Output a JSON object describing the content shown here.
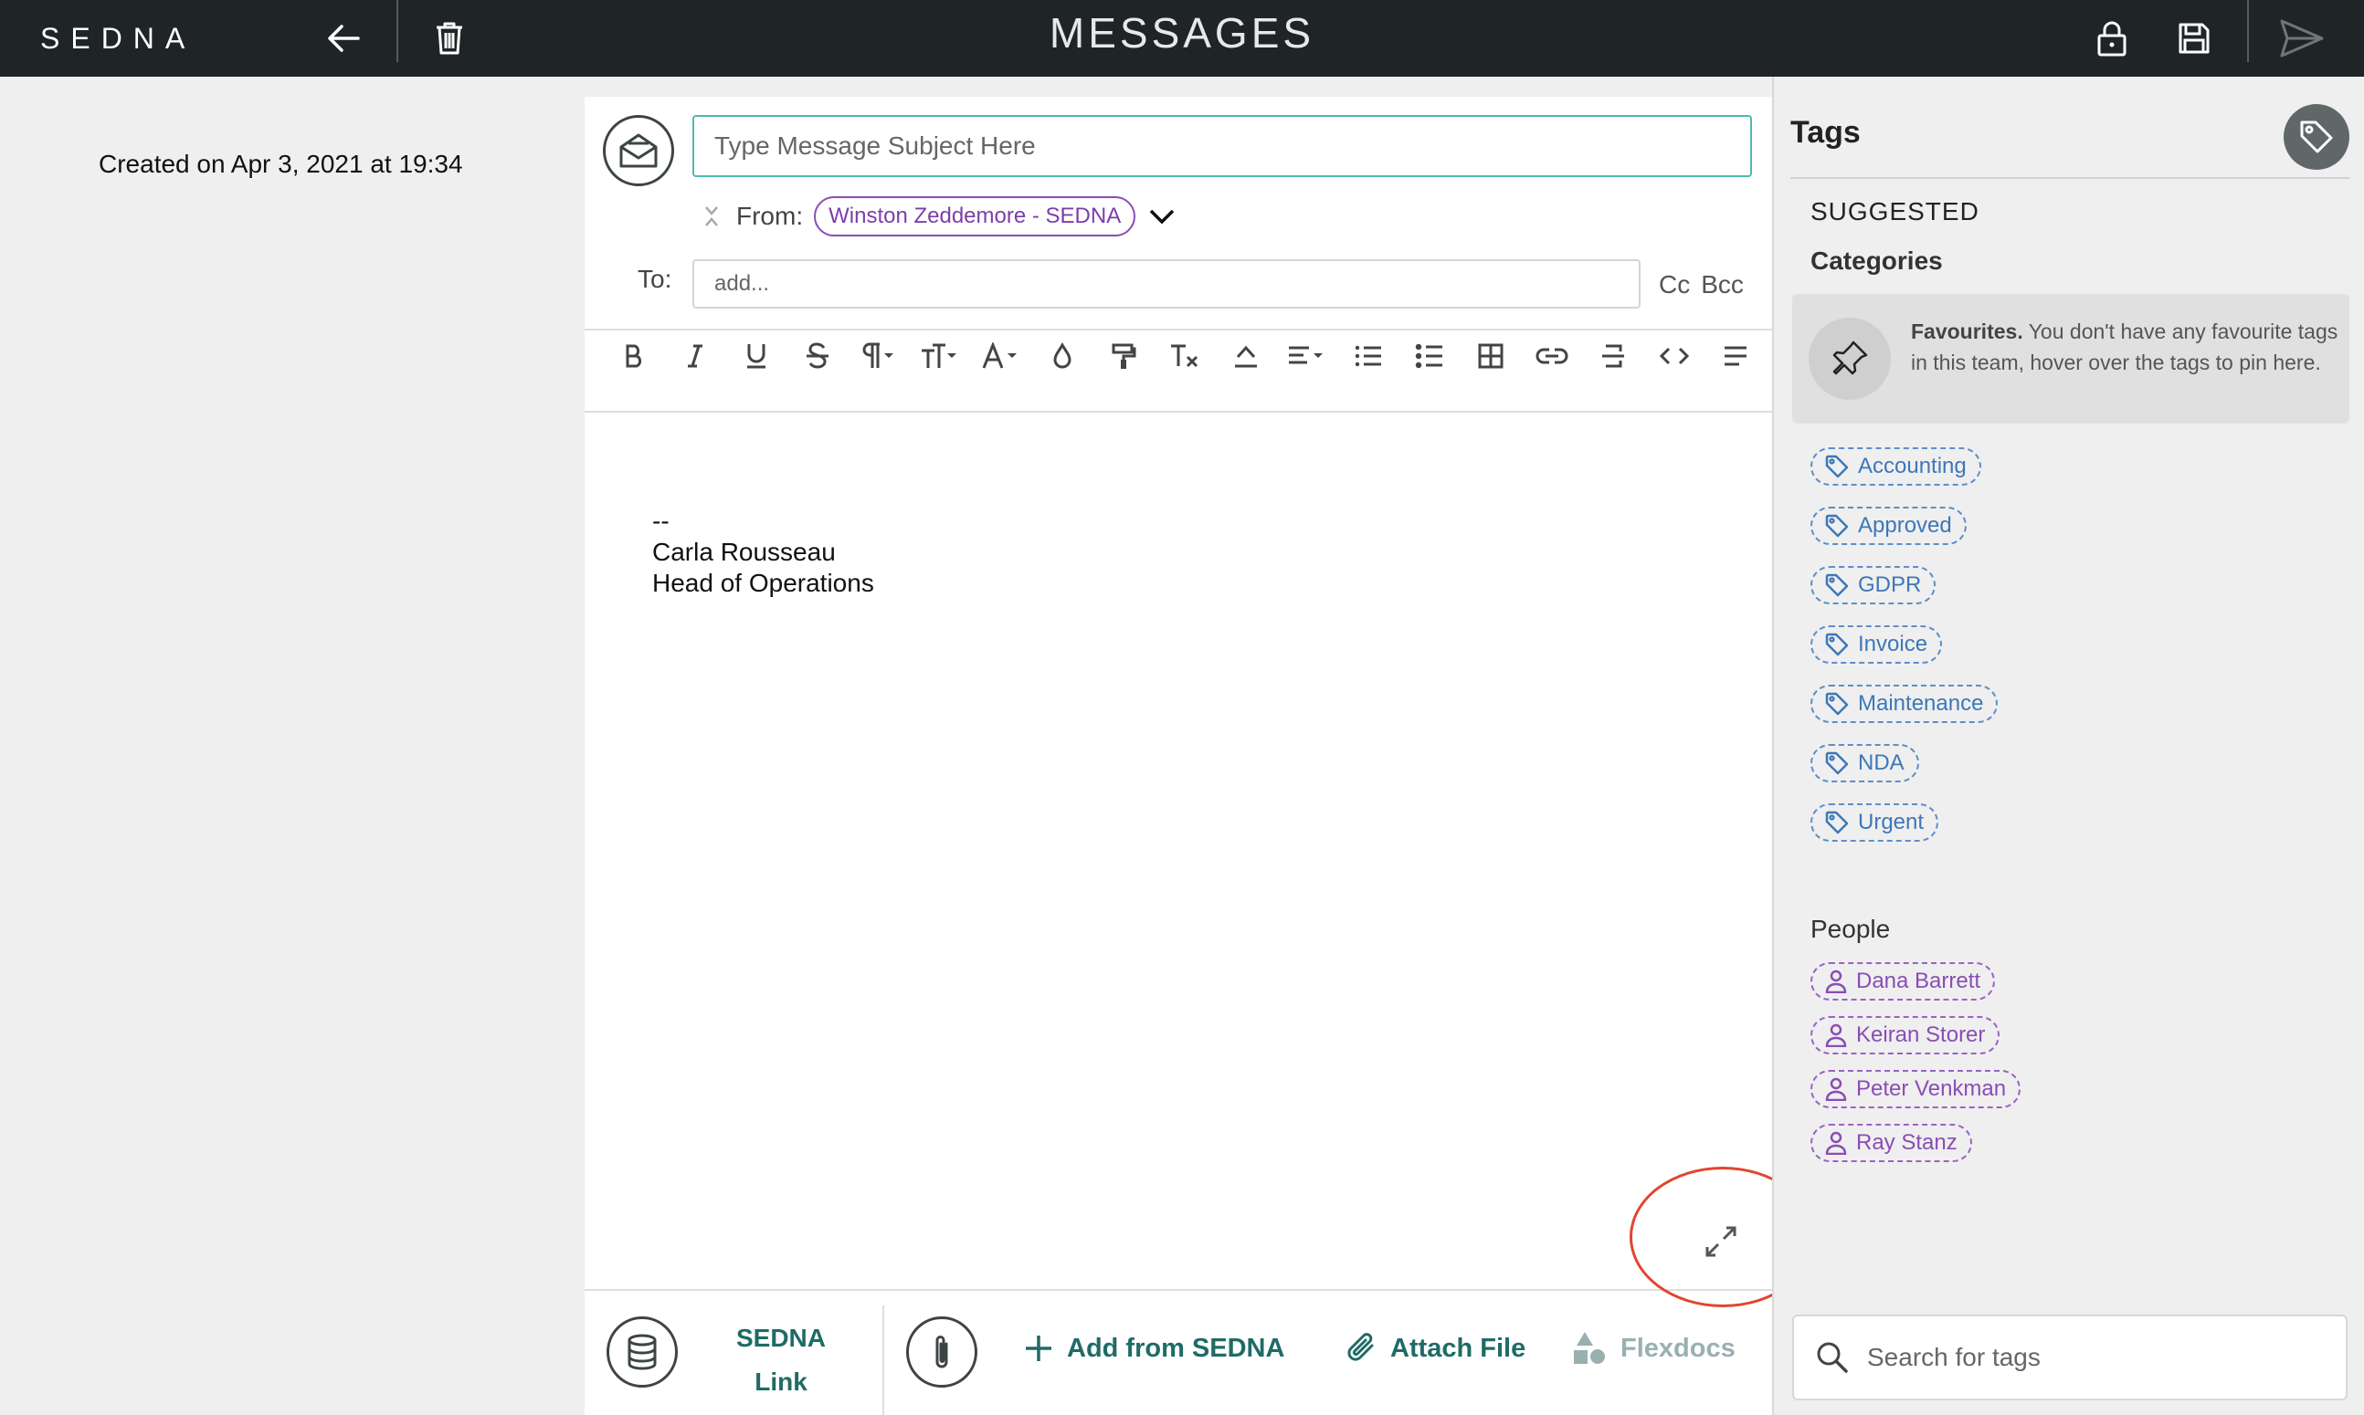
{
  "header": {
    "logo": "SEDNA",
    "title": "MESSAGES"
  },
  "meta": {
    "created": "Created on Apr 3, 2021 at 19:34"
  },
  "composer": {
    "subject_placeholder": "Type Message Subject Here",
    "from_label": "From:",
    "from_value": "Winston Zeddemore - SEDNA",
    "to_label": "To:",
    "to_placeholder": "add...",
    "cc": "Cc",
    "bcc": "Bcc",
    "toolbar": [
      "bold-icon",
      "italic-icon",
      "underline-icon",
      "strikethrough-icon",
      "paragraph-icon",
      "font-size-icon",
      "font-color-icon",
      "highlight-icon",
      "format-painter-icon",
      "clear-format-icon",
      "horizontal-rule-icon",
      "align-icon",
      "bullet-list-icon",
      "numbered-list-icon",
      "table-icon",
      "link-icon",
      "divider-icon",
      "code-icon",
      "more-icon"
    ],
    "body_lines": [
      "--",
      "Carla Rousseau",
      "Head of Operations"
    ]
  },
  "bottom": {
    "sedna_link_line1": "SEDNA",
    "sedna_link_line2": "Link",
    "add_from_sedna": "Add from SEDNA",
    "attach_file": "Attach File",
    "flexdocs": "Flexdocs"
  },
  "tags_panel": {
    "title": "Tags",
    "suggested": "SUGGESTED",
    "categories": "Categories",
    "favourites_bold": "Favourites.",
    "favourites_text": " You don't have any favourite tags in this team, hover over the tags to pin here.",
    "tags": [
      "Accounting",
      "Approved",
      "GDPR",
      "Invoice",
      "Maintenance",
      "NDA",
      "Urgent"
    ],
    "people_label": "People",
    "people": [
      "Dana Barrett",
      "Keiran Storer",
      "Peter Venkman",
      "Ray Stanz"
    ],
    "search_placeholder": "Search for tags"
  },
  "colors": {
    "topbar": "#1f2526",
    "accent_teal": "#1f6b66",
    "tag_blue": "#3d77b8",
    "person_purple": "#8a4db6",
    "highlight_ring": "#e0462f"
  }
}
